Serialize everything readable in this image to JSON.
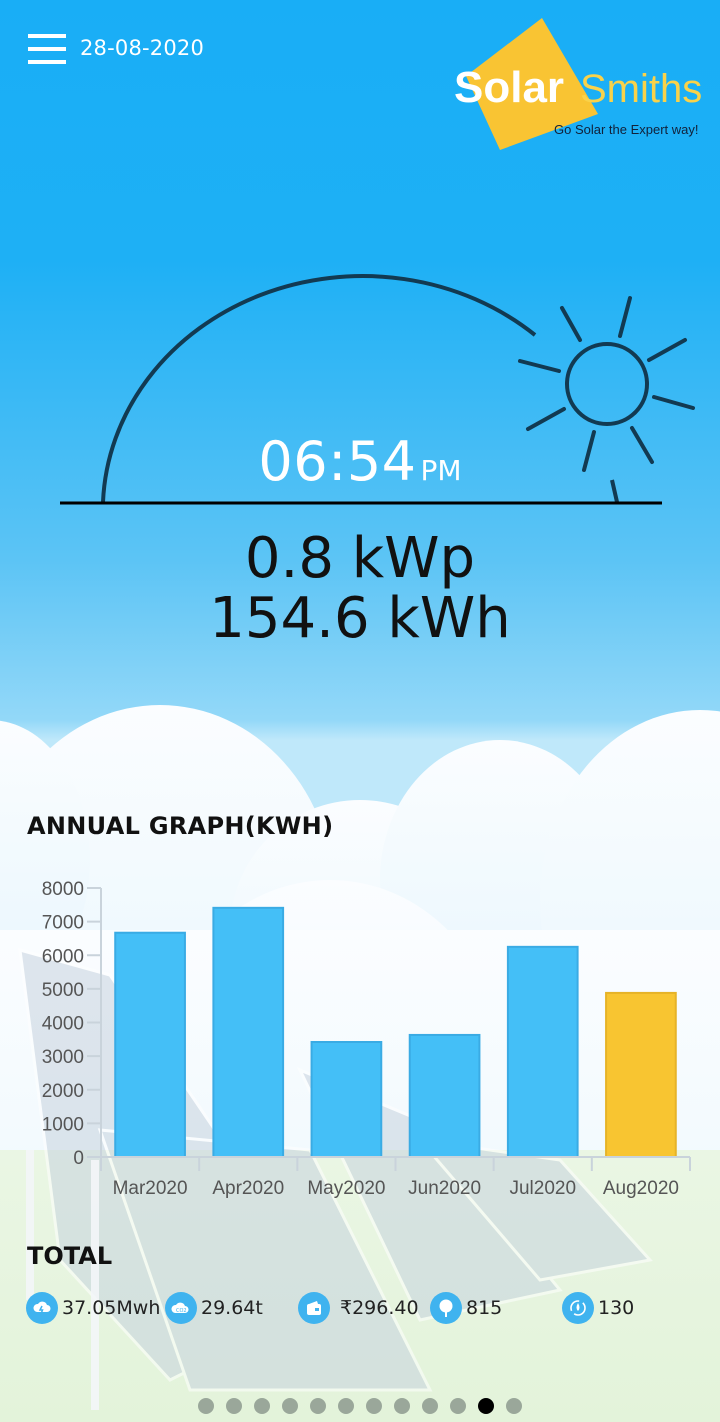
{
  "header": {
    "date": "28-08-2020",
    "menu_icon": "hamburger-menu-icon"
  },
  "logo": {
    "word1": "Solar",
    "word2": "Smiths",
    "tagline": "Go Solar the Expert way!",
    "colors": {
      "square": "#f9c433",
      "word1": "#ffffff",
      "word2": "#f9d24a",
      "tagline": "#12213a"
    }
  },
  "sun_panel": {
    "time": "06:54",
    "ampm": "PM",
    "power": "0.8 kWp",
    "energy": "154.6 kWh",
    "sun_icon": "sun-icon"
  },
  "annual": {
    "title": "ANNUAL GRAPH(KWH)"
  },
  "chart_data": {
    "type": "bar",
    "title": "ANNUAL GRAPH(KWH)",
    "xlabel": "",
    "ylabel": "",
    "categories": [
      "Mar2020",
      "Apr2020",
      "May2020",
      "Jun2020",
      "Jul2020",
      "Aug2020"
    ],
    "values": [
      6670,
      7410,
      3420,
      3630,
      6250,
      4880
    ],
    "highlight_index": 5,
    "colors": {
      "bar": "#44bff7",
      "bar_border": "#3aabe4",
      "highlight": "#f8c531",
      "highlight_border": "#e6b328",
      "axis": "#c9d3db",
      "tick_text": "#555555"
    },
    "ylim": [
      0,
      8000
    ],
    "yticks": [
      0,
      1000,
      2000,
      3000,
      4000,
      5000,
      6000,
      7000,
      8000
    ],
    "grid": false,
    "legend": "none"
  },
  "totals": {
    "title": "TOTAL",
    "items": [
      {
        "icon": "energy-cloud-icon",
        "value": "37.05Mwh"
      },
      {
        "icon": "co2-cloud-icon",
        "value": "29.64t"
      },
      {
        "icon": "wallet-icon",
        "value": "₹296.40"
      },
      {
        "icon": "tree-icon",
        "value": "815"
      },
      {
        "icon": "recycle-drop-icon",
        "value": "130"
      }
    ]
  },
  "pager": {
    "count": 12,
    "active_index": 10
  }
}
